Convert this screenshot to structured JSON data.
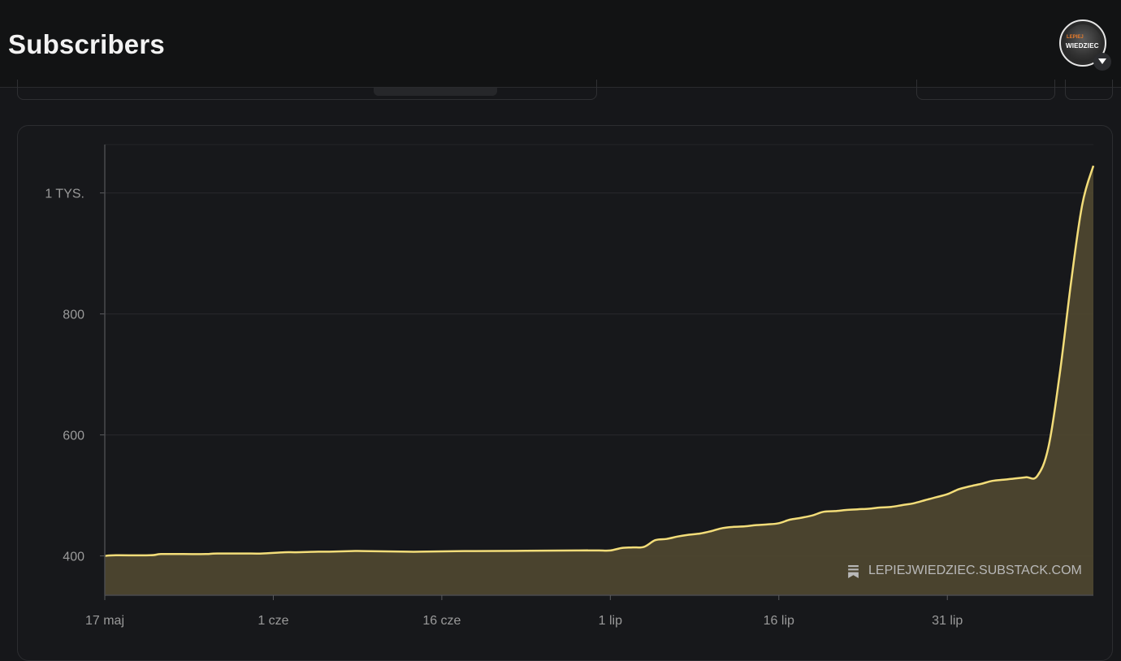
{
  "header": {
    "title": "Subscribers"
  },
  "avatar": {
    "line1": "LEPIEJ",
    "line2": "WIEDZIEC"
  },
  "watermark": {
    "text": "LEPIEJWIEDZIEC.SUBSTACK.COM"
  },
  "chart_data": {
    "type": "area",
    "title": "",
    "xlabel": "",
    "ylabel": "",
    "ylim": [
      335,
      1080
    ],
    "y_ticks": [
      400,
      600,
      800,
      1000
    ],
    "y_tick_labels": [
      "400",
      "600",
      "800",
      "1 TYS."
    ],
    "x_ticks": [
      "2023-05-17",
      "2023-06-01",
      "2023-06-16",
      "2023-07-01",
      "2023-07-16",
      "2023-07-31"
    ],
    "x_tick_labels": [
      "17 maj",
      "1 cze",
      "16 cze",
      "1 lip",
      "16 lip",
      "31 lip"
    ],
    "x_range": [
      "2023-05-17",
      "2023-08-13"
    ],
    "grid": true,
    "colors": {
      "line": "#f3dd79",
      "fill": "#4f4830"
    },
    "series": [
      {
        "x": [
          "2023-05-17",
          "2023-05-18",
          "2023-05-21",
          "2023-05-22",
          "2023-05-24",
          "2023-05-26",
          "2023-05-27",
          "2023-05-30",
          "2023-05-31",
          "2023-06-02",
          "2023-06-03",
          "2023-06-05",
          "2023-06-06",
          "2023-06-08",
          "2023-06-09",
          "2023-06-13",
          "2023-06-14",
          "2023-06-18",
          "2023-06-19",
          "2023-06-28",
          "2023-06-29",
          "2023-06-30",
          "2023-07-01",
          "2023-07-02",
          "2023-07-03",
          "2023-07-04",
          "2023-07-05",
          "2023-07-06",
          "2023-07-07",
          "2023-07-08",
          "2023-07-09",
          "2023-07-10",
          "2023-07-11",
          "2023-07-12",
          "2023-07-13",
          "2023-07-14",
          "2023-07-15",
          "2023-07-16",
          "2023-07-17",
          "2023-07-18",
          "2023-07-19",
          "2023-07-20",
          "2023-07-21",
          "2023-07-22",
          "2023-07-23",
          "2023-07-24",
          "2023-07-25",
          "2023-07-26",
          "2023-07-27",
          "2023-07-28",
          "2023-07-29",
          "2023-07-30",
          "2023-07-31",
          "2023-08-01",
          "2023-08-02",
          "2023-08-03",
          "2023-08-04",
          "2023-08-05",
          "2023-08-06",
          "2023-08-07",
          "2023-08-08",
          "2023-08-09",
          "2023-08-10",
          "2023-08-11",
          "2023-08-12",
          "2023-08-13"
        ],
        "values": [
          400,
          401,
          401,
          403,
          403,
          403,
          404,
          404,
          404,
          406,
          406,
          407,
          407,
          408,
          408,
          407,
          407,
          408,
          408,
          409,
          409,
          409,
          409,
          413,
          414,
          415,
          426,
          428,
          432,
          435,
          437,
          441,
          446,
          448,
          449,
          451,
          452,
          454,
          460,
          463,
          467,
          473,
          474,
          476,
          477,
          478,
          480,
          481,
          484,
          487,
          492,
          497,
          502,
          510,
          515,
          519,
          524,
          526,
          528,
          530,
          532,
          580,
          700,
          850,
          980,
          1045
        ]
      }
    ]
  }
}
